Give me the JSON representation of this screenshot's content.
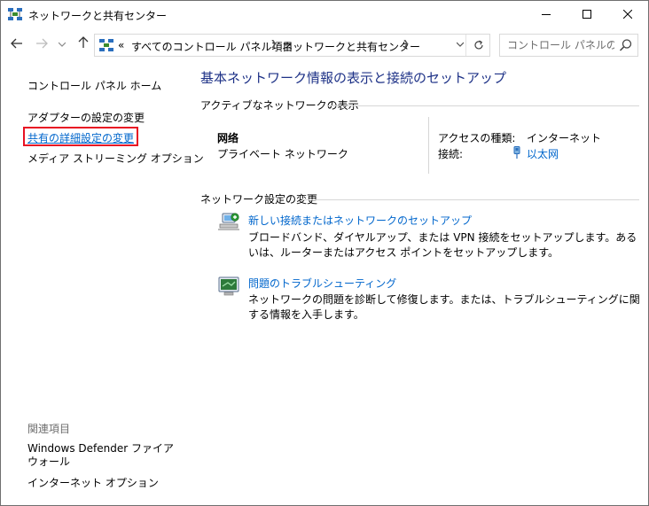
{
  "window": {
    "title": "ネットワークと共有センター"
  },
  "address_bar": {
    "overflow": "«",
    "crumbs": [
      "すべてのコントロール パネル項目",
      "ネットワークと共有センター"
    ]
  },
  "search": {
    "placeholder": "コントロール パネルの検索"
  },
  "left_pane": {
    "home": "コントロール パネル ホーム",
    "links": [
      "アダプターの設定の変更",
      "共有の詳細設定の変更",
      "メディア ストリーミング オプション"
    ],
    "related_title": "関連項目",
    "related": [
      "Windows Defender ファイアウォール",
      "インターネット オプション"
    ],
    "highlight_color": "#e81123"
  },
  "main": {
    "title": "基本ネットワーク情報の表示と接続のセットアップ",
    "active_section": "アクティブなネットワークの表示",
    "network_name": "网络",
    "network_type": "プライベート ネットワーク",
    "access_label": "アクセスの種類:",
    "access_value": "インターネット",
    "connection_label": "接続:",
    "connection_value": "以太网",
    "change_section": "ネットワーク設定の変更",
    "tasks": [
      {
        "link": "新しい接続またはネットワークのセットアップ",
        "desc": "ブロードバンド、ダイヤルアップ、または VPN 接続をセットアップします。あるいは、ルーターまたはアクセス ポイントをセットアップします。",
        "icon": "new-connection-icon"
      },
      {
        "link": "問題のトラブルシューティング",
        "desc": "ネットワークの問題を診断して修復します。または、トラブルシューティングに関する情報を入手します。",
        "icon": "troubleshoot-icon"
      }
    ]
  },
  "colors": {
    "title_blue": "#1e3287",
    "link_blue": "#0066cc"
  }
}
